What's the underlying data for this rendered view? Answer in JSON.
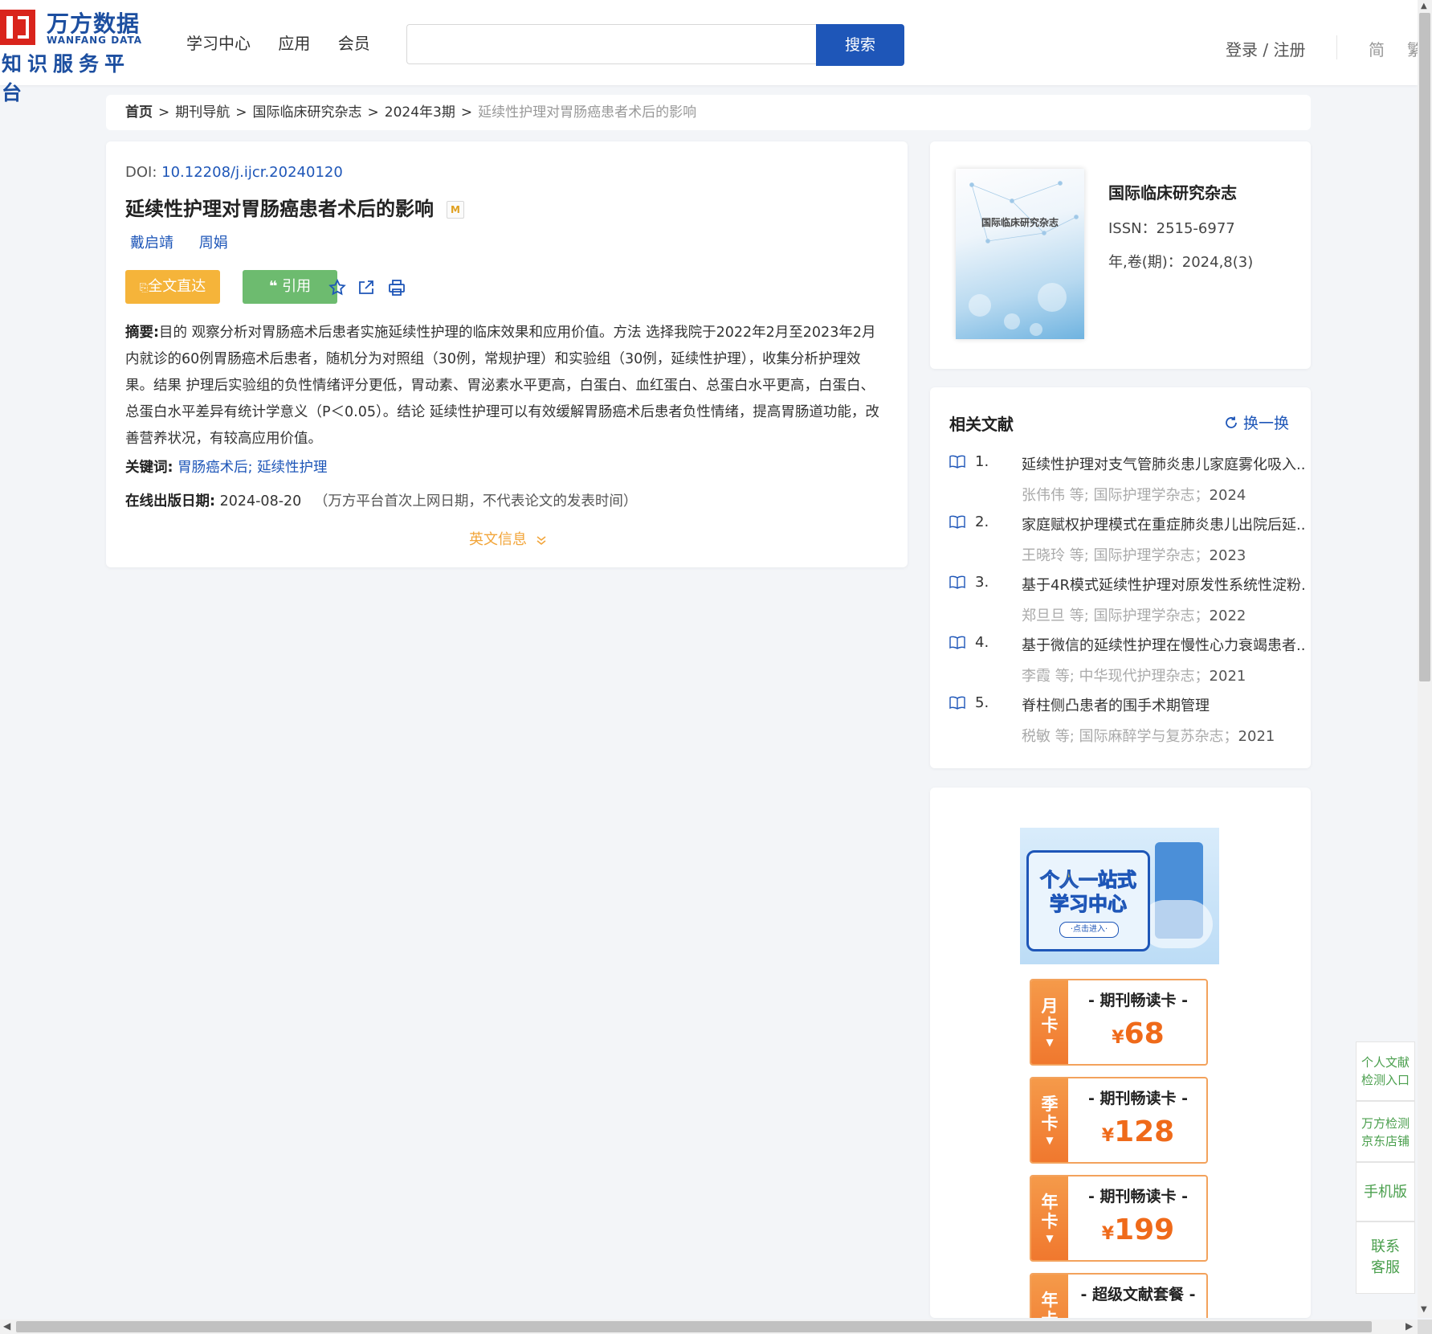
{
  "header": {
    "logo": {
      "cn": "万方数据",
      "en": "WANFANG DATA",
      "sub": "知识服务平台"
    },
    "nav": [
      "学习中心",
      "应用",
      "会员"
    ],
    "search": {
      "placeholder": "",
      "button": "搜索"
    },
    "login": "登录 / 注册",
    "lang_simplified": "简",
    "lang_traditional": "繁"
  },
  "breadcrumb": {
    "home": "首页",
    "separator": ">",
    "items": [
      "期刊导航",
      "国际临床研究杂志",
      "2024年3期"
    ],
    "current": "延续性护理对胃肠癌患者术后的影响"
  },
  "article": {
    "doi_label": "DOI:",
    "doi": "10.12208/j.ijcr.20240120",
    "title": "延续性护理对胃肠癌患者术后的影响",
    "badge": "M",
    "authors": [
      "戴启靖",
      "周娟"
    ],
    "btn_fulltext": "全文直达",
    "btn_cite": "引用",
    "tools": [
      "star-icon",
      "share-icon",
      "print-icon"
    ],
    "abstract_label": "摘要:",
    "abstract": "目的 观察分析对胃肠癌术后患者实施延续性护理的临床效果和应用价值。方法 选择我院于2022年2月至2023年2月内就诊的60例胃肠癌术后患者，随机分为对照组（30例，常规护理）和实验组（30例，延续性护理），收集分析护理效果。结果 护理后实验组的负性情绪评分更低，胃动素、胃泌素水平更高，白蛋白、血红蛋白、总蛋白水平更高，白蛋白、总蛋白水平差异有统计学意义（P＜0.05）。结论 延续性护理可以有效缓解胃肠癌术后患者负性情绪，提高胃肠道功能，改善营养状况，有较高应用价值。",
    "keywords_label": "关键词:",
    "keywords": [
      "胃肠癌术后",
      "延续性护理"
    ],
    "online_label": "在线出版日期:",
    "online_date": "2024-08-20",
    "online_note": "（万方平台首次上网日期，不代表论文的发表时间）",
    "english_info": "英文信息"
  },
  "journal": {
    "cover_title": "国际临床研究杂志",
    "name": "国际临床研究杂志",
    "issn": "ISSN：2515-6977",
    "year_vol": "年,卷(期)：2024,8(3)"
  },
  "related": {
    "title": "相关文献",
    "refresh": "换一换",
    "items": [
      {
        "num": "1.",
        "title": "延续性护理对支气管肺炎患儿家庭雾化吸入...",
        "author": "张伟伟",
        "deng": "等;",
        "journal": "国际护理学杂志；",
        "year": "2024"
      },
      {
        "num": "2.",
        "title": "家庭赋权护理模式在重症肺炎患儿出院后延...",
        "author": "王晓玲",
        "deng": "等;",
        "journal": "国际护理学杂志；",
        "year": "2023"
      },
      {
        "num": "3.",
        "title": "基于4R模式延续性护理对原发性系统性淀粉...",
        "author": "郑旦旦",
        "deng": "等;",
        "journal": "国际护理学杂志；",
        "year": "2022"
      },
      {
        "num": "4.",
        "title": "基于微信的延续性护理在慢性心力衰竭患者...",
        "author": "李霞",
        "deng": "等;",
        "journal": "中华现代护理杂志；",
        "year": "2021"
      },
      {
        "num": "5.",
        "title": "脊柱侧凸患者的围手术期管理",
        "author": "税敏",
        "deng": "等;",
        "journal": "国际麻醉学与复苏杂志；",
        "year": "2021"
      }
    ]
  },
  "promo": {
    "banner_line1": "个人一站式",
    "banner_line2": "学习中心",
    "banner_button": "·点击进入·",
    "cards": [
      {
        "c1": "月",
        "c2": "卡",
        "name": "- 期刊畅读卡 -",
        "yen": "¥",
        "price": "68"
      },
      {
        "c1": "季",
        "c2": "卡",
        "name": "- 期刊畅读卡 -",
        "yen": "¥",
        "price": "128"
      },
      {
        "c1": "年",
        "c2": "卡",
        "name": "- 期刊畅读卡 -",
        "yen": "¥",
        "price": "199"
      },
      {
        "c1": "年",
        "c2": "卡",
        "name": "- 超级文献套餐 -",
        "yen": "¥",
        "price": ""
      }
    ]
  },
  "float_bar": {
    "item1_l1": "个人文献",
    "item1_l2": "检测入口",
    "item2_l1": "万方检测",
    "item2_l2": "京东店铺",
    "item3": "手机版",
    "item4_l1": "联系",
    "item4_l2": "客服"
  },
  "colors": {
    "brand_blue": "#1e56b8",
    "logo_red": "#d9241c",
    "orange": "#f5b43a",
    "green": "#6dbb6f",
    "price_orange": "#ef6a1a"
  }
}
